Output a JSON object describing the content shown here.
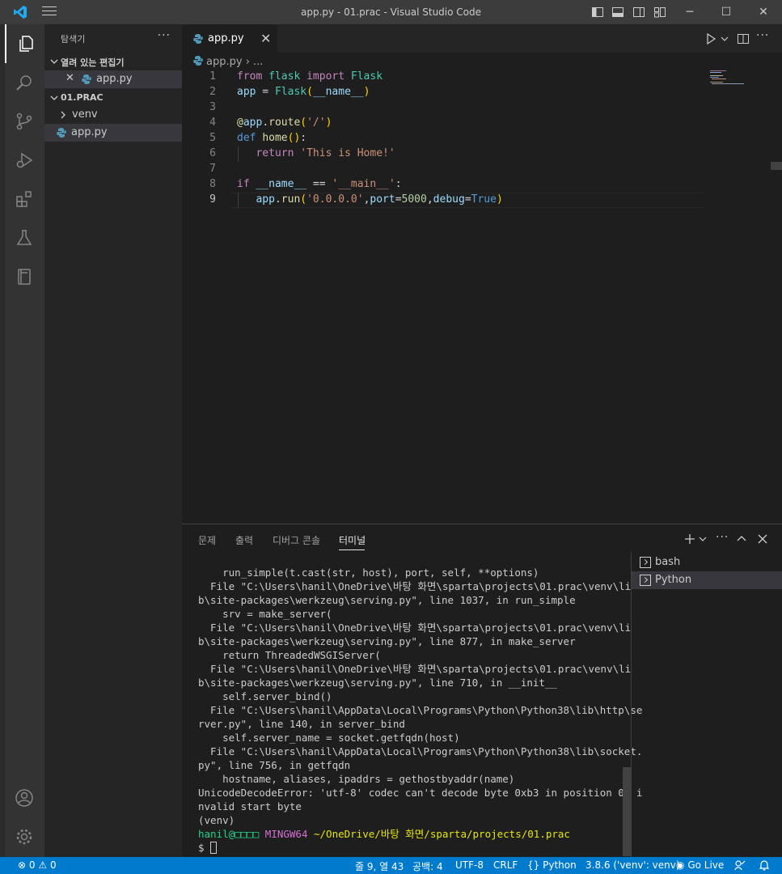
{
  "window": {
    "title": "app.py - 01.prac - Visual Studio Code"
  },
  "activity_bar": {
    "items": [
      "explorer-icon",
      "search-icon",
      "source-control-icon",
      "run-debug-icon",
      "extensions-icon",
      "testing-icon",
      "notebook-icon"
    ],
    "bottom": [
      "account-icon",
      "manage-gear-icon"
    ]
  },
  "sidebar": {
    "title": "탐색기",
    "more": "···",
    "open_editors": {
      "header": "열려 있는 편집기",
      "items": [
        {
          "close": "✕",
          "label": "app.py"
        }
      ]
    },
    "folder": {
      "header": "01.PRAC",
      "items": [
        {
          "label": "venv",
          "type": "folder"
        },
        {
          "label": "app.py",
          "type": "python-file"
        }
      ]
    }
  },
  "editor": {
    "tab": {
      "label": "app.py",
      "close": "✕"
    },
    "breadcrumb": {
      "file": "app.py",
      "sep": "›",
      "more": "..."
    },
    "line_numbers": [
      "1",
      "2",
      "3",
      "4",
      "5",
      "6",
      "7",
      "8",
      "9"
    ],
    "current_line": 9
  },
  "panel": {
    "tabs": [
      "문제",
      "출력",
      "디버그 콘솔",
      "터미널"
    ],
    "active_tab": "터미널",
    "terminal_lines": [
      "    run_simple(t.cast(str, host), port, self, **options)",
      "  File \"C:\\Users\\hanil\\OneDrive\\바탕 화면\\sparta\\projects\\01.prac\\venv\\li",
      "b\\site-packages\\werkzeug\\serving.py\", line 1037, in run_simple",
      "    srv = make_server(",
      "  File \"C:\\Users\\hanil\\OneDrive\\바탕 화면\\sparta\\projects\\01.prac\\venv\\li",
      "b\\site-packages\\werkzeug\\serving.py\", line 877, in make_server",
      "    return ThreadedWSGIServer(",
      "  File \"C:\\Users\\hanil\\OneDrive\\바탕 화면\\sparta\\projects\\01.prac\\venv\\li",
      "b\\site-packages\\werkzeug\\serving.py\", line 710, in __init__",
      "    self.server_bind()",
      "  File \"C:\\Users\\hanil\\AppData\\Local\\Programs\\Python\\Python38\\lib\\http\\se",
      "rver.py\", line 140, in server_bind",
      "    self.server_name = socket.getfqdn(host)",
      "  File \"C:\\Users\\hanil\\AppData\\Local\\Programs\\Python\\Python38\\lib\\socket.",
      "py\", line 756, in getfqdn",
      "    hostname, aliases, ipaddrs = gethostbyaddr(name)",
      "UnicodeDecodeError: 'utf-8' codec can't decode byte 0xb3 in position 0: i",
      "nvalid start byte",
      "(venv)"
    ],
    "prompt": {
      "user": "hanil@□□□□",
      "shell": "MINGW64",
      "path": "~/OneDrive/바탕 화면/sparta/projects/01.prac",
      "symbol": "$"
    },
    "terminals": [
      {
        "label": "bash"
      },
      {
        "label": "Python"
      }
    ]
  },
  "statusbar": {
    "errors": "0",
    "warnings": "0",
    "position": "줄 9, 열 43",
    "spaces": "공백: 4",
    "encoding": "UTF-8",
    "eol": "CRLF",
    "language": "Python",
    "interpreter": "3.8.6 ('venv': venv)",
    "golive": "Go Live"
  },
  "colors": {
    "accent": "#007acc",
    "python_icon": "#519aba"
  }
}
